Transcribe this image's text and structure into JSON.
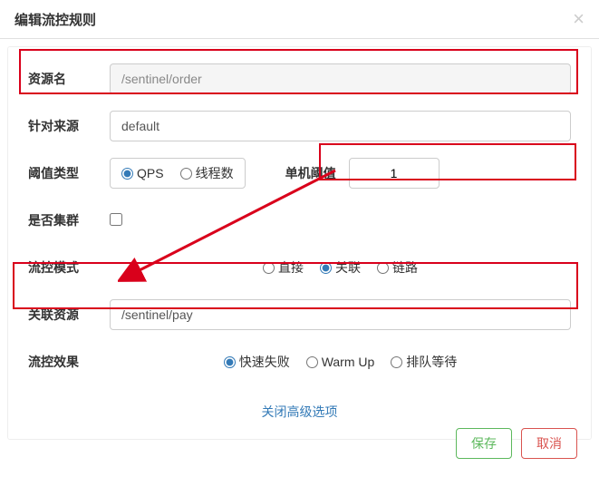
{
  "modal": {
    "title": "编辑流控规则",
    "close": "×"
  },
  "form": {
    "resourceLabel": "资源名",
    "resourceValue": "/sentinel/order",
    "sourceLabel": "针对来源",
    "sourceValue": "default",
    "thresholdTypeLabel": "阈值类型",
    "thresholdTypes": {
      "qps": "QPS",
      "threads": "线程数"
    },
    "singleThresholdLabel": "单机阈值",
    "singleThresholdValue": "1",
    "clusterLabel": "是否集群",
    "flowModeLabel": "流控模式",
    "flowModes": {
      "direct": "直接",
      "relate": "关联",
      "chain": "链路"
    },
    "relateResourceLabel": "关联资源",
    "relateResourceValue": "/sentinel/pay",
    "flowEffectLabel": "流控效果",
    "flowEffects": {
      "fastFail": "快速失败",
      "warmUp": "Warm Up",
      "queue": "排队等待"
    },
    "advancedToggle": "关闭高级选项"
  },
  "footer": {
    "save": "保存",
    "cancel": "取消"
  }
}
